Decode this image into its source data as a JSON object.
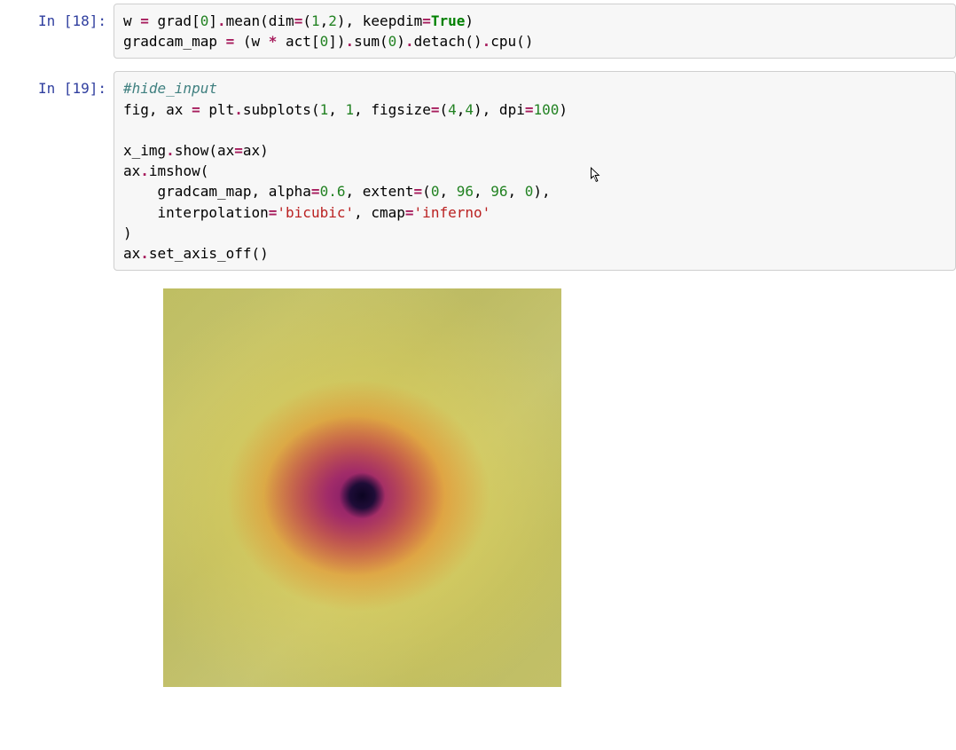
{
  "cells": {
    "cell18": {
      "prompt": "In [18]:",
      "code": {
        "line1": {
          "name1": "w ",
          "op1": "= ",
          "name2": "grad[",
          "num1": "0",
          "name3": "]",
          "op2": ".",
          "name4": "mean(dim",
          "op3": "=",
          "name5": "(",
          "num2": "1",
          "name6": ",",
          "num3": "2",
          "name7": "), keepdim",
          "op4": "=",
          "kw1": "True",
          "name8": ")"
        },
        "line2": {
          "name1": "gradcam_map ",
          "op1": "= ",
          "name2": "(w ",
          "op2": "*",
          "name3": " act[",
          "num1": "0",
          "name4": "])",
          "op3": ".",
          "name5": "sum(",
          "num2": "0",
          "name6": ")",
          "op4": ".",
          "name7": "detach()",
          "op5": ".",
          "name8": "cpu()"
        }
      }
    },
    "cell19": {
      "prompt": "In [19]:",
      "code": {
        "line1": {
          "comment": "#hide_input"
        },
        "line2": {
          "name1": "fig, ax ",
          "op1": "= ",
          "name2": "plt",
          "op2": ".",
          "name3": "subplots(",
          "num1": "1",
          "name4": ", ",
          "num2": "1",
          "name5": ", figsize",
          "op3": "=",
          "name6": "(",
          "num3": "4",
          "name7": ",",
          "num4": "4",
          "name8": "), dpi",
          "op4": "=",
          "num5": "100",
          "name9": ")"
        },
        "line3": {
          "name1": "x_img",
          "op1": ".",
          "name2": "show(ax",
          "op2": "=",
          "name3": "ax)"
        },
        "line4": {
          "name1": "ax",
          "op1": ".",
          "name2": "imshow("
        },
        "line5": {
          "indent": "    ",
          "name1": "gradcam_map, alpha",
          "op1": "=",
          "num1": "0.6",
          "name2": ", extent",
          "op2": "=",
          "name3": "(",
          "num2": "0",
          "name4": ", ",
          "num3": "96",
          "name5": ", ",
          "num4": "96",
          "name6": ", ",
          "num5": "0",
          "name7": "),"
        },
        "line6": {
          "indent": "    ",
          "name1": "interpolation",
          "op1": "=",
          "str1": "'bicubic'",
          "name2": ", cmap",
          "op2": "=",
          "str2": "'inferno'"
        },
        "line7": {
          "name1": ")"
        },
        "line8": {
          "name1": "ax",
          "op1": ".",
          "name2": "set_axis_off()"
        }
      }
    }
  }
}
